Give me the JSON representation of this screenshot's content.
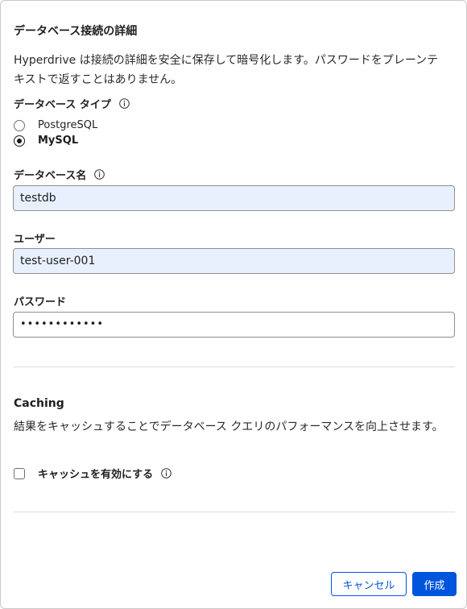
{
  "connection": {
    "title": "データベース接続の詳細",
    "description": "Hyperdrive は接続の詳細を安全に保存して暗号化します。パスワードをプレーンテキストで返すことはありません。",
    "db_type_label": "データベース タイプ",
    "db_type_options": [
      {
        "label": "PostgreSQL",
        "selected": false
      },
      {
        "label": "MySQL",
        "selected": true
      }
    ],
    "db_name_label": "データベース名",
    "db_name_value": "testdb",
    "user_label": "ユーザー",
    "user_value": "test-user-001",
    "password_label": "パスワード",
    "password_masked": "••••••••••••"
  },
  "caching": {
    "title": "Caching",
    "description": "結果をキャッシュすることでデータベース クエリのパフォーマンスを向上させます。",
    "enable_label": "キャッシュを有効にする",
    "enabled": false
  },
  "actions": {
    "cancel_label": "キャンセル",
    "create_label": "作成"
  },
  "colors": {
    "primary": "#0055dc",
    "autofill_bg": "#e8f0fe",
    "border": "#8f8f8f"
  },
  "icons": {
    "info": "info-circle-icon"
  }
}
